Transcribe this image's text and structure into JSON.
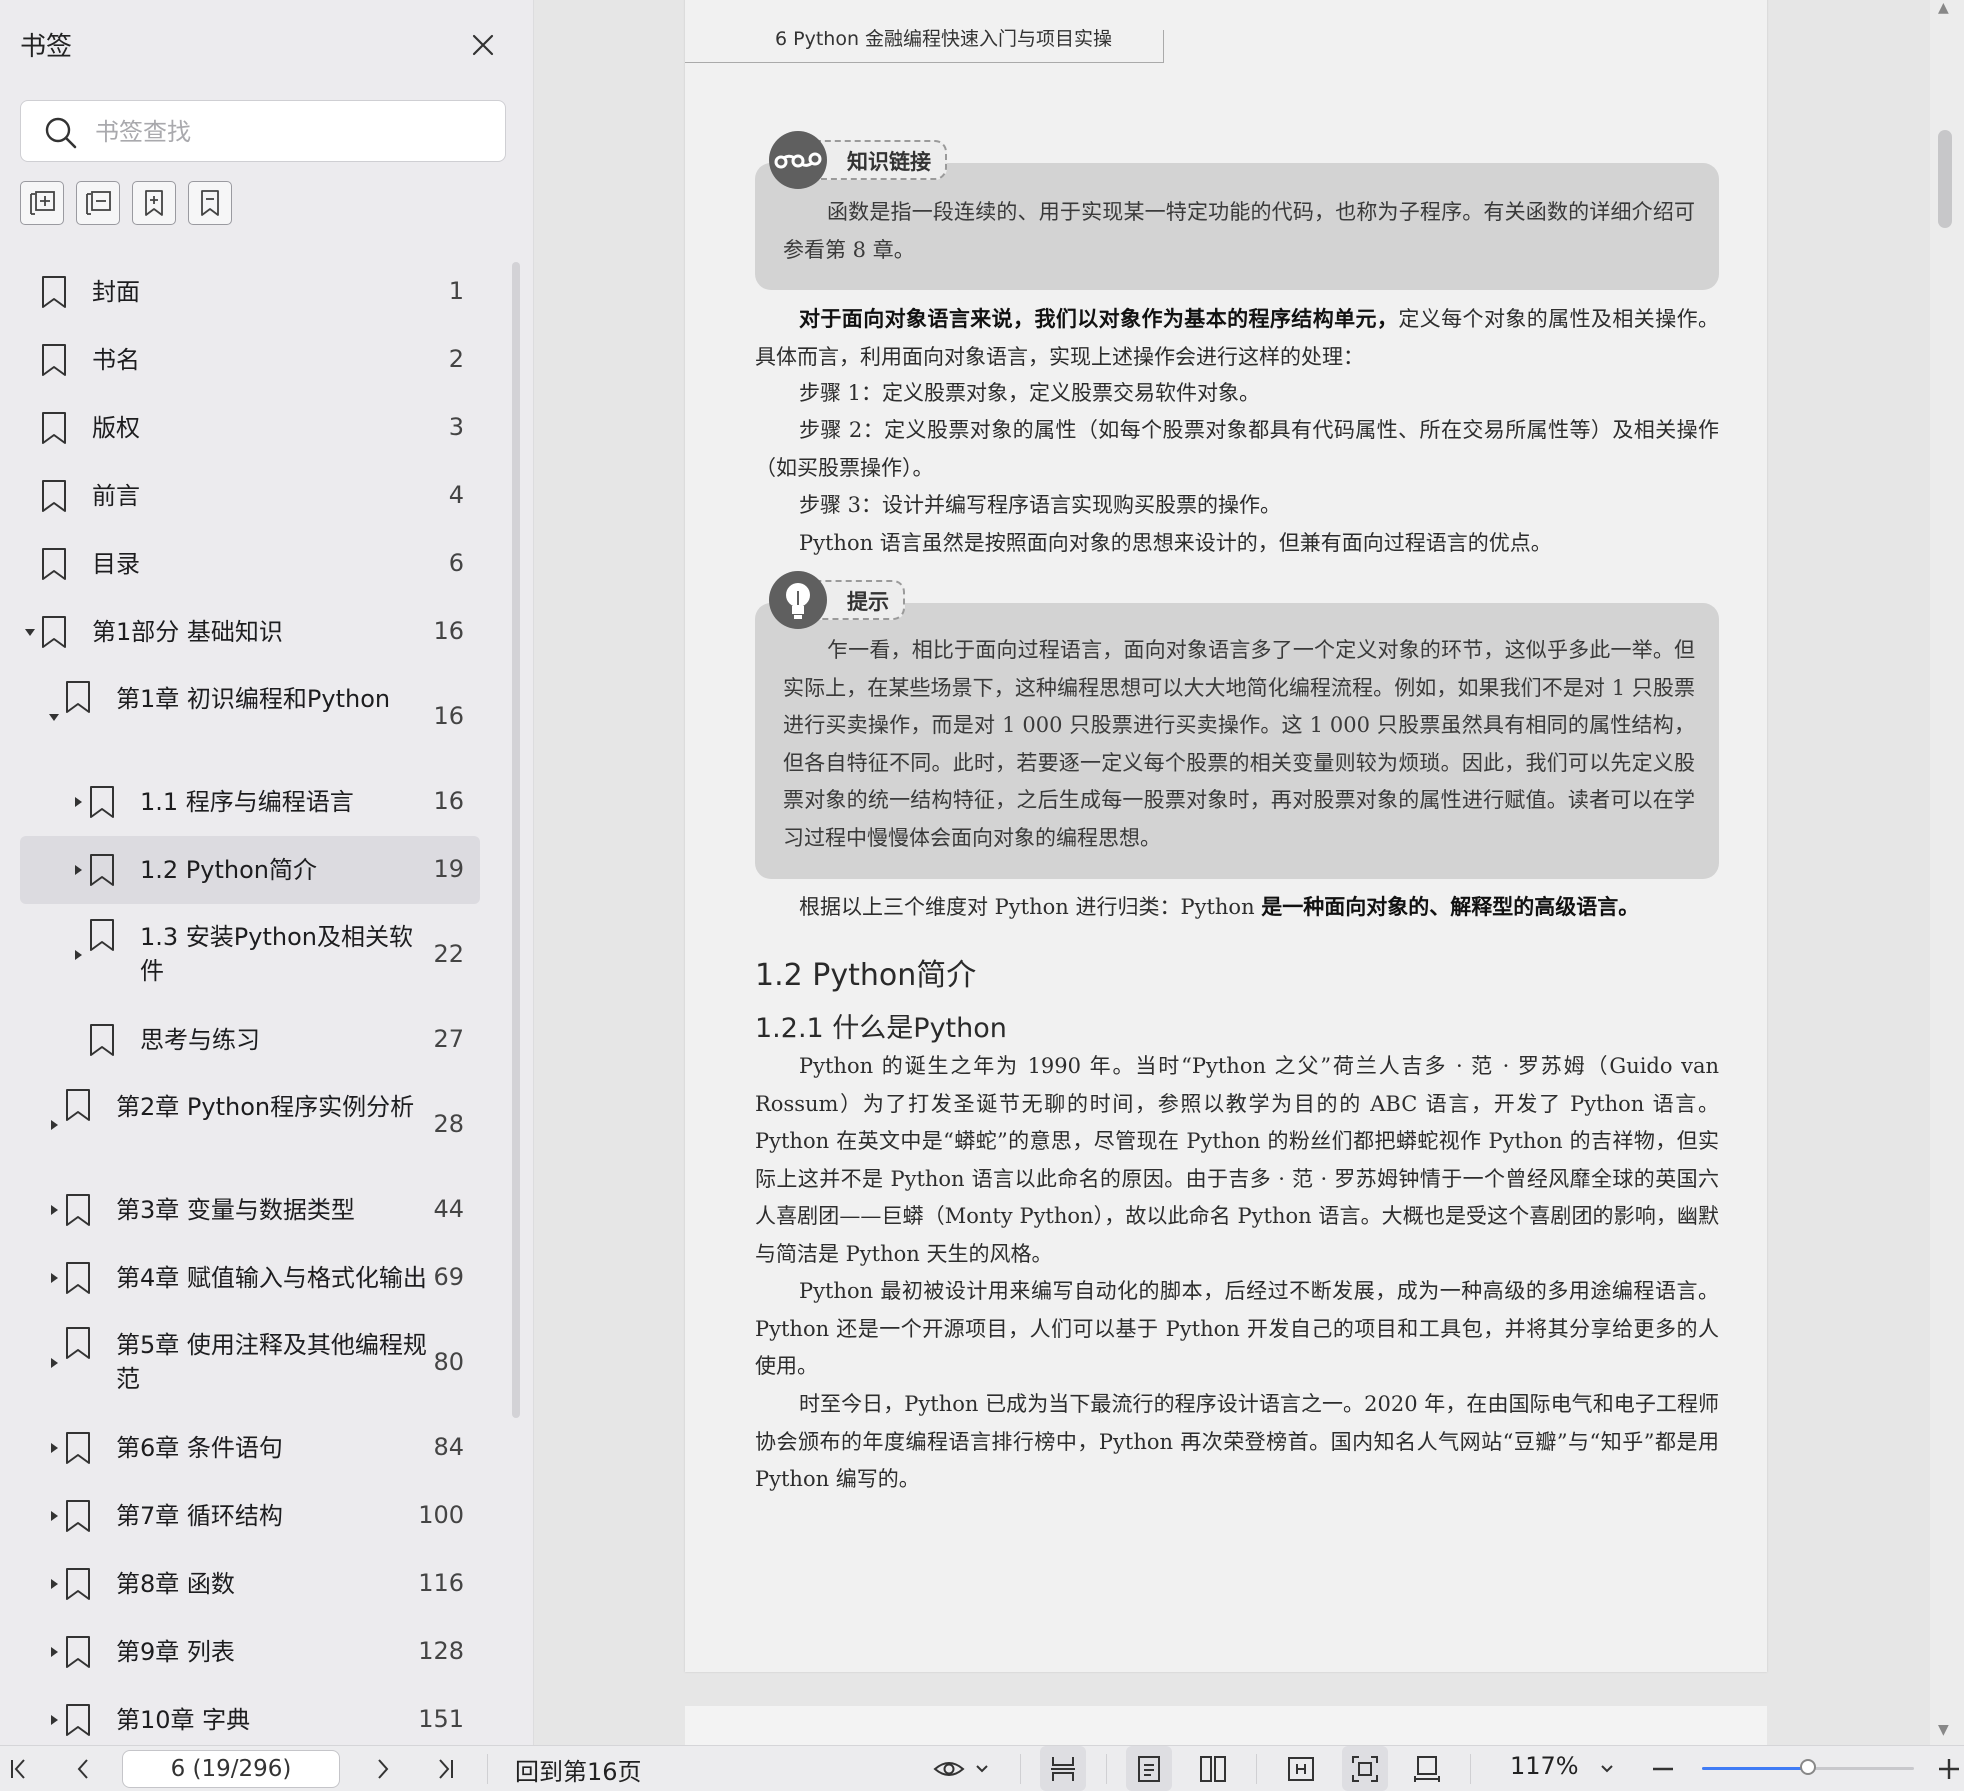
{
  "sidebar": {
    "title": "书签",
    "search_placeholder": "书签查找",
    "tools": [
      "expand-all",
      "collapse-all",
      "add-bookmark",
      "bookmark"
    ],
    "items": [
      {
        "label": "封面",
        "page": "1",
        "level": 0,
        "arrow": "none",
        "selected": false
      },
      {
        "label": "书名",
        "page": "2",
        "level": 0,
        "arrow": "none",
        "selected": false
      },
      {
        "label": "版权",
        "page": "3",
        "level": 0,
        "arrow": "none",
        "selected": false
      },
      {
        "label": "前言",
        "page": "4",
        "level": 0,
        "arrow": "none",
        "selected": false
      },
      {
        "label": "目录",
        "page": "6",
        "level": 0,
        "arrow": "none",
        "selected": false
      },
      {
        "label": "第1部分  基础知识",
        "page": "16",
        "level": 0,
        "arrow": "down",
        "selected": false
      },
      {
        "label": "第1章  初识编程和Python",
        "page": "16",
        "level": 1,
        "arrow": "down",
        "selected": false
      },
      {
        "label": "1.1  程序与编程语言",
        "page": "16",
        "level": 2,
        "arrow": "right",
        "selected": false
      },
      {
        "label": "1.2  Python简介",
        "page": "19",
        "level": 2,
        "arrow": "right",
        "selected": true
      },
      {
        "label": "1.3  安装Python及相关软件",
        "page": "22",
        "level": 2,
        "arrow": "right",
        "selected": false
      },
      {
        "label": "思考与练习",
        "page": "27",
        "level": 2,
        "arrow": "none",
        "selected": false
      },
      {
        "label": "第2章  Python程序实例分析",
        "page": "28",
        "level": 1,
        "arrow": "right",
        "selected": false
      },
      {
        "label": "第3章  变量与数据类型",
        "page": "44",
        "level": 1,
        "arrow": "right",
        "selected": false
      },
      {
        "label": "第4章  赋值输入与格式化输出",
        "page": "69",
        "level": 1,
        "arrow": "right",
        "selected": false
      },
      {
        "label": "第5章  使用注释及其他编程规范",
        "page": "80",
        "level": 1,
        "arrow": "right",
        "selected": false
      },
      {
        "label": "第6章  条件语句",
        "page": "84",
        "level": 1,
        "arrow": "right",
        "selected": false
      },
      {
        "label": "第7章  循环结构",
        "page": "100",
        "level": 1,
        "arrow": "right",
        "selected": false
      },
      {
        "label": "第8章  函数",
        "page": "116",
        "level": 1,
        "arrow": "right",
        "selected": false
      },
      {
        "label": "第9章  列表",
        "page": "128",
        "level": 1,
        "arrow": "right",
        "selected": false
      },
      {
        "label": "第10章  字典",
        "page": "151",
        "level": 1,
        "arrow": "right",
        "selected": false
      }
    ]
  },
  "document": {
    "header": "6   Python 金融编程快速入门与项目实操",
    "knowledge_tag": "知识链接",
    "knowledge_text": "函数是指一段连续的、用于实现某一特定功能的代码，也称为子程序。有关函数的详细介绍可参看第 8 章。",
    "p1_bold": "对于面向对象语言来说，我们以对象作为基本的程序结构单元，",
    "p1_rest": "定义每个对象的属性及相关操作。具体而言，利用面向对象语言，实现上述操作会进行这样的处理：",
    "step1": "步骤 1：定义股票对象，定义股票交易软件对象。",
    "step2": "步骤 2：定义股票对象的属性（如每个股票对象都具有代码属性、所在交易所属性等）及相关操作（如买股票操作）。",
    "step3": "步骤 3：设计并编写程序语言实现购买股票的操作。",
    "p_lang": "Python 语言虽然是按照面向对象的思想来设计的，但兼有面向过程语言的优点。",
    "tip_tag": "提示",
    "tip_text": "乍一看，相比于面向过程语言，面向对象语言多了一个定义对象的环节，这似乎多此一举。但实际上，在某些场景下，这种编程思想可以大大地简化编程流程。例如，如果我们不是对 1 只股票进行买卖操作，而是对 1 000 只股票进行买卖操作。这 1 000 只股票虽然具有相同的属性结构，但各自特征不同。此时，若要逐一定义每个股票的相关变量则较为烦琐。因此，我们可以先定义股票对象的统一结构特征，之后生成每一股票对象时，再对股票对象的属性进行赋值。读者可以在学习过程中慢慢体会面向对象的编程思想。",
    "summary_pre": "根据以上三个维度对 Python 进行归类：Python ",
    "summary_bold": "是一种面向对象的、解释型的高级语言。",
    "section": "1.2   Python简介",
    "subsection": "1.2.1   什么是Python",
    "para1": "Python 的诞生之年为 1990 年。当时“Python 之父”荷兰人吉多 · 范 · 罗苏姆（Guido van Rossum）为了打发圣诞节无聊的时间，参照以教学为目的的 ABC 语言，开发了 Python 语言。Python 在英文中是“蟒蛇”的意思，尽管现在 Python 的粉丝们都把蟒蛇视作 Python 的吉祥物，但实际上这并不是 Python 语言以此命名的原因。由于吉多 · 范 · 罗苏姆钟情于一个曾经风靡全球的英国六人喜剧团——巨蟒（Monty Python），故以此命名 Python 语言。大概也是受这个喜剧团的影响，幽默与简洁是 Python 天生的风格。",
    "para2": "Python 最初被设计用来编写自动化的脚本，后经过不断发展，成为一种高级的多用途编程语言。Python 还是一个开源项目，人们可以基于 Python 开发自己的项目和工具包，并将其分享给更多的人使用。",
    "para3": "时至今日，Python 已成为当下最流行的程序设计语言之一。2020 年，在由国际电气和电子工程师协会颁布的年度编程语言排行榜中，Python 再次荣登榜首。国内知名人气网站“豆瓣”与“知乎”都是用 Python 编写的。"
  },
  "bottom_bar": {
    "page_field": "6 (19/296)",
    "back_label": "回到第16页",
    "zoom": "117%",
    "zoom_level": 0.5
  }
}
